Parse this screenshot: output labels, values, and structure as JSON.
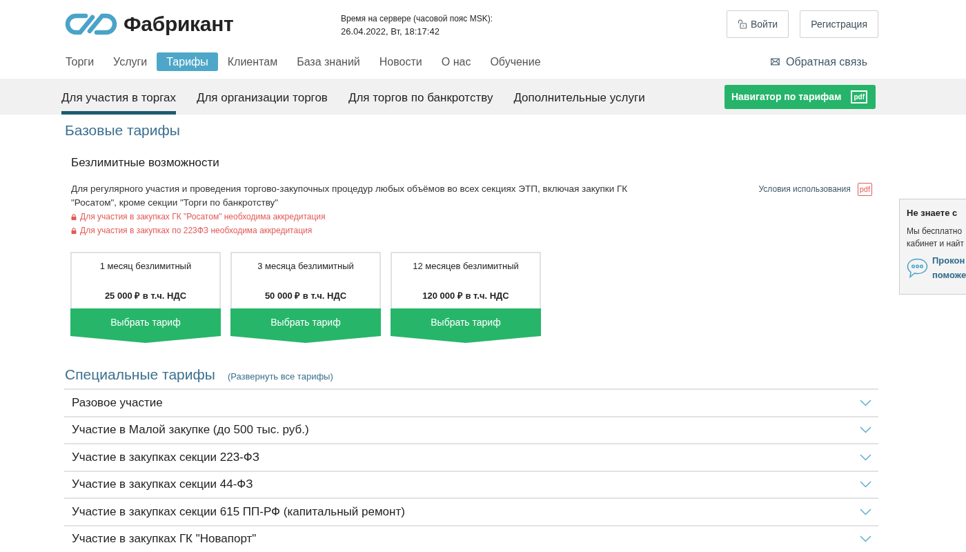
{
  "header": {
    "logo": {
      "name": "Фабрикант"
    },
    "server_time": {
      "label": "Время на сервере (часовой пояс MSK):",
      "value": "26.04.2022, Вт, 18:17:42"
    },
    "buttons": [
      {
        "label": "Войти",
        "kind": "login"
      },
      {
        "label": "Регистрация",
        "kind": "plain"
      }
    ]
  },
  "main_nav": {
    "items": [
      {
        "label": "Торги",
        "selected": false
      },
      {
        "label": "Услуги",
        "selected": false
      },
      {
        "label": "Тарифы",
        "selected": true
      },
      {
        "label": "Клиентам",
        "selected": false
      },
      {
        "label": "База знаний",
        "selected": false
      },
      {
        "label": "Новости",
        "selected": false
      },
      {
        "label": "О нас",
        "selected": false
      },
      {
        "label": "Обучение",
        "selected": false
      }
    ],
    "feedback_link": "Обратная связь"
  },
  "sub_nav": {
    "tabs": [
      {
        "label": "Для участия в торгах",
        "selected": true
      },
      {
        "label": "Для организации торгов",
        "selected": false
      },
      {
        "label": "Для торгов по банкротству",
        "selected": false
      },
      {
        "label": "Дополнительные услуги",
        "selected": false
      }
    ],
    "navigator_button": {
      "label": "Навигатор по тарифам",
      "badge": "pdf"
    }
  },
  "base_tariffs": {
    "title": "Базовые тарифы",
    "group": {
      "title": "Безлимитные возможности",
      "description": "Для регулярного участия и проведения торгово-закупочных процедур любых объёмов во всех секциях ЭТП, включая закупки ГК \"Росатом\", кроме секции \"Торги по банкротству\"",
      "notes": [
        "Для участия в закупках ГК \"Росатом\" необходима аккредитация",
        "Для участия в закупках по 223ФЗ необходима аккредитация"
      ],
      "terms_link": {
        "label": "Условия использования",
        "badge": "pdf"
      }
    },
    "plans": [
      {
        "name": "1 месяц безлимитный",
        "price": "25 000 ₽ в т.ч. НДС",
        "button": "Выбрать тариф"
      },
      {
        "name": "3 месяца безлимитный",
        "price": "50 000 ₽ в т.ч. НДС",
        "button": "Выбрать тариф"
      },
      {
        "name": "12 месяцев безлимитный",
        "price": "120 000 ₽ в т.ч. НДС",
        "button": "Выбрать тариф"
      }
    ]
  },
  "special_tariffs": {
    "title": "Специальные тарифы",
    "expand_all_link": "(Развернуть все тарифы)",
    "items": [
      {
        "label": "Разовое участие",
        "expanded": false
      },
      {
        "label": "Участие в Малой закупке (до 500 тыс. руб.)",
        "expanded": false
      },
      {
        "label": "Участие в закупках секции 223-ФЗ",
        "expanded": false
      },
      {
        "label": "Участие в закупках секции 44-ФЗ",
        "expanded": false
      },
      {
        "label": "Участие в закупках секции 615 ПП-РФ (капитальный ремонт)",
        "expanded": false
      },
      {
        "label": "Участие в закупках ГК \"Новапорт\"",
        "expanded": false
      }
    ]
  },
  "help_widget": {
    "title": "Не знаете с",
    "text_lines": [
      "Мы бесплатно",
      "кабинет и найт"
    ],
    "link_lines": [
      "Прокон",
      "поможе"
    ]
  }
}
